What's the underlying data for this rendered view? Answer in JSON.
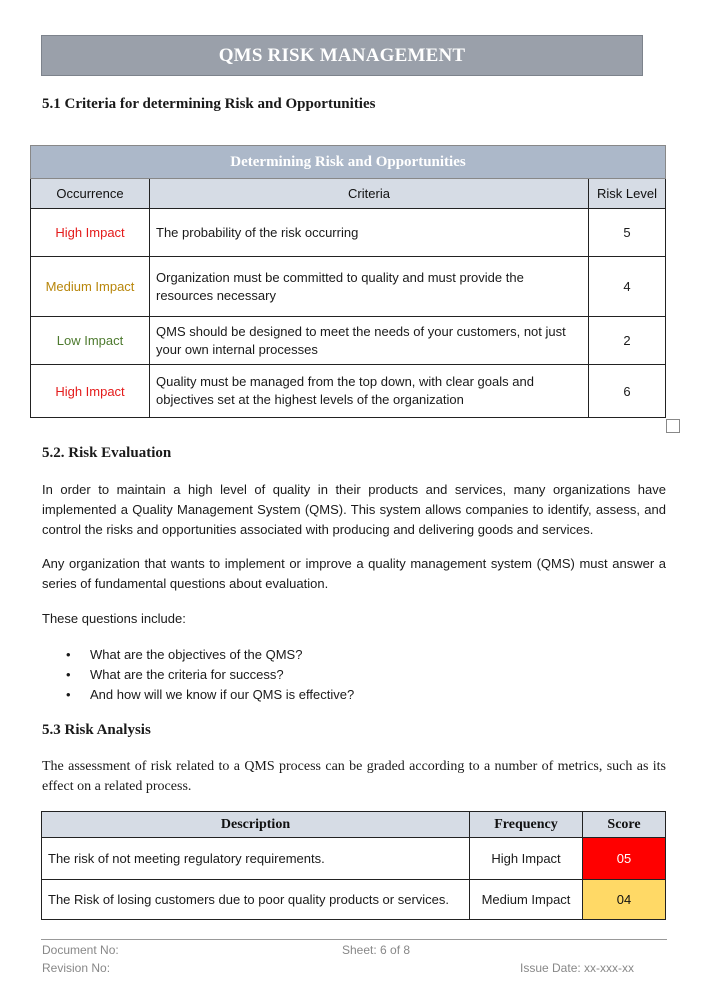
{
  "header": {
    "title": "QMS RISK MANAGEMENT"
  },
  "section1": {
    "heading": "5.1 Criteria for determining Risk and Opportunities",
    "table": {
      "caption": "Determining Risk and Opportunities",
      "columns": [
        "Occurrence",
        "Criteria",
        "Risk Level"
      ],
      "rows": [
        {
          "occurrence": "High Impact",
          "occurrence_color": "#e41b1b",
          "criteria": "The probability of the risk occurring",
          "risk_level": "5"
        },
        {
          "occurrence": "Medium Impact",
          "occurrence_color": "#b8860b",
          "criteria": "Organization must be committed to quality and must provide the resources necessary",
          "risk_level": "4"
        },
        {
          "occurrence": "Low Impact",
          "occurrence_color": "#4d7a2e",
          "criteria": "QMS should be designed to meet the needs of your customers, not just your own internal processes",
          "risk_level": "2"
        },
        {
          "occurrence": "High Impact",
          "occurrence_color": "#e41b1b",
          "criteria": "Quality must be managed from the top down, with clear goals and objectives set at the highest levels of the organization",
          "risk_level": "6"
        }
      ]
    }
  },
  "section2": {
    "heading": "5.2. Risk Evaluation",
    "paragraphs": [
      "In order to maintain a high level of quality in their products and services, many organizations have implemented a Quality Management System (QMS). This system allows companies to identify, assess, and control the risks and opportunities associated with producing and delivering goods and services.",
      "Any organization that wants to implement or improve a quality management system (QMS) must answer a series of fundamental questions about evaluation.",
      "These questions include:"
    ],
    "bullets": [
      "What are the objectives of the QMS?",
      "What are the criteria for success?",
      "And how will we know if our QMS is effective?"
    ]
  },
  "section3": {
    "heading": "5.3 Risk Analysis",
    "paragraph": "The assessment of risk related to a QMS process can be graded according to a number of metrics, such as its effect on a related process.",
    "table": {
      "columns": [
        "Description",
        "Frequency",
        "Score"
      ],
      "rows": [
        {
          "description": "The risk of not meeting regulatory requirements.",
          "frequency": "High Impact",
          "score": "05",
          "score_color": "#ff0000"
        },
        {
          "description": "The Risk of losing customers due to poor quality products or services.",
          "frequency": "Medium Impact",
          "score": "04",
          "score_color": "#ffd966"
        }
      ]
    }
  },
  "footer": {
    "document_no": "Document No:",
    "revision_no": "Revision No:",
    "sheet": "Sheet: 6 of 8",
    "issue_date": "Issue Date: xx-xxx-xx"
  }
}
